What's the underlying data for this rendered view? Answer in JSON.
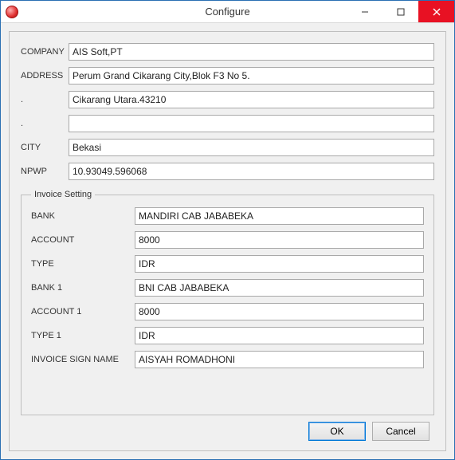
{
  "window": {
    "title": "Configure"
  },
  "form": {
    "company_label": "COMPANY",
    "company_value": "AIS Soft,PT",
    "address_label": "ADDRESS",
    "address_value": "Perum Grand Cikarang City,Blok F3 No 5.",
    "addr2_label": ".",
    "addr2_value": "Cikarang Utara.43210",
    "addr3_label": ".",
    "addr3_value": "",
    "city_label": "CITY",
    "city_value": "Bekasi",
    "npwp_label": "NPWP",
    "npwp_value": "10.93049.596068"
  },
  "invoice": {
    "legend": "Invoice Setting",
    "bank_label": "BANK",
    "bank_value": "MANDIRI CAB JABABEKA",
    "account_label": "ACCOUNT",
    "account_value": "8000",
    "type_label": "TYPE",
    "type_value": "IDR",
    "bank1_label": "BANK 1",
    "bank1_value": "BNI CAB JABABEKA",
    "account1_label": "ACCOUNT 1",
    "account1_value": "8000",
    "type1_label": "TYPE 1",
    "type1_value": "IDR",
    "sign_label": "INVOICE SIGN NAME",
    "sign_value": "AISYAH ROMADHONI"
  },
  "buttons": {
    "ok": "OK",
    "cancel": "Cancel"
  }
}
